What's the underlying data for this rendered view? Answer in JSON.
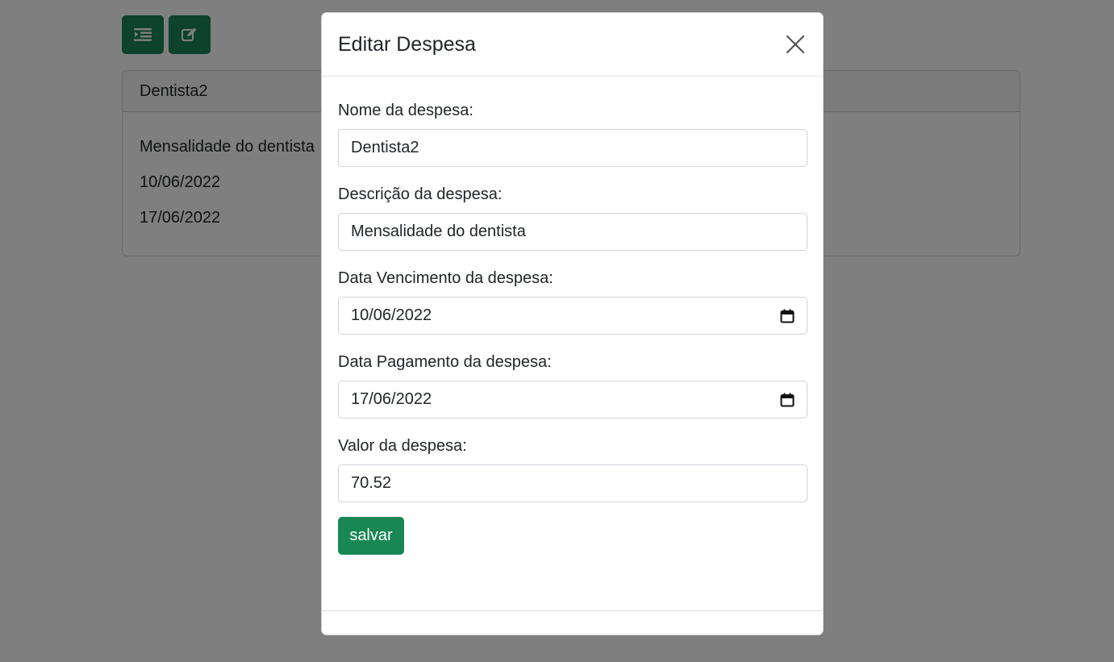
{
  "toolbar": {
    "list_icon": "list-indent-icon",
    "edit_icon": "edit-icon",
    "accent_color": "#198754"
  },
  "card": {
    "header": "Dentista2",
    "description": "Mensalidade do dentista",
    "due_date": "10/06/2022",
    "paid_date": "17/06/2022"
  },
  "modal": {
    "title": "Editar Despesa",
    "close_icon": "close-icon",
    "fields": {
      "name": {
        "label": "Nome da despesa:",
        "value": "Dentista2"
      },
      "description": {
        "label": "Descrição da despesa:",
        "value": "Mensalidade do dentista"
      },
      "due_date": {
        "label": "Data Vencimento da despesa:",
        "value": "10/06/2022"
      },
      "paid_date": {
        "label": "Data Pagamento da despesa:",
        "value": "17/06/2022"
      },
      "amount": {
        "label": "Valor da despesa:",
        "value": "70.52"
      }
    },
    "save_label": "salvar"
  }
}
